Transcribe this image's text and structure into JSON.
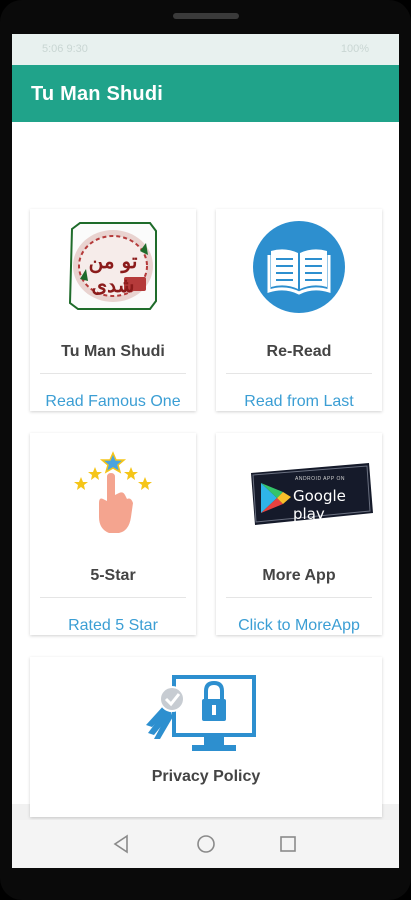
{
  "status_bar": {
    "left_text": "5:06  9:30",
    "right_text": "100%"
  },
  "app_bar": {
    "title": "Tu Man Shudi"
  },
  "cards": [
    {
      "title": "Tu Man Shudi",
      "link": "Read Famous One",
      "icon": "book-cover-icon"
    },
    {
      "title": "Re-Read",
      "link": "Read from Last",
      "icon": "open-book-icon"
    },
    {
      "title": "5-Star",
      "link": "Rated 5 Star",
      "icon": "five-star-rating-icon"
    },
    {
      "title": "More App",
      "link": "Click to MoreApp",
      "icon": "google-play-badge-icon"
    }
  ],
  "privacy": {
    "title": "Privacy Policy",
    "icon": "secure-monitor-icon"
  },
  "book_cover_text": "تو من شدی",
  "google_play": {
    "small": "ANDROID APP ON",
    "big": "Google play"
  },
  "nav": {
    "back": "back-icon",
    "home": "home-icon",
    "recents": "recents-icon"
  },
  "colors": {
    "primary": "#20a38a",
    "link": "#3b9ed4",
    "icon_blue": "#2d8fcf"
  }
}
